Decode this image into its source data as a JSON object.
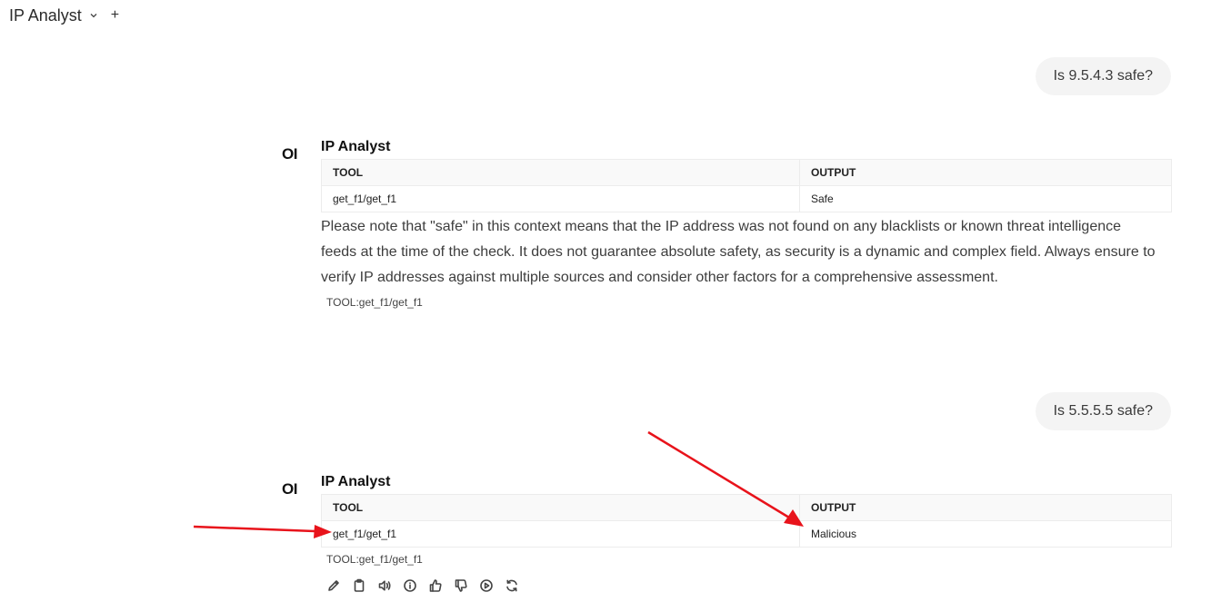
{
  "header": {
    "model_name": "IP Analyst",
    "new_chat_label": "+"
  },
  "conversation": [
    {
      "role": "user",
      "text": "Is 9.5.4.3 safe?"
    },
    {
      "role": "assistant",
      "avatar_text": "OI",
      "name": "IP Analyst",
      "table": {
        "headers": [
          "TOOL",
          "OUTPUT"
        ],
        "rows": [
          [
            "get_f1/get_f1",
            "Safe"
          ]
        ]
      },
      "paragraph": "Please note that \"safe\" in this context means that the IP address was not found on any blacklists or known threat intelligence feeds at the time of the check. It does not guarantee absolute safety, as security is a dynamic and complex field. Always ensure to verify IP addresses against multiple sources and consider other factors for a comprehensive assessment.",
      "tool_tag": "TOOL:get_f1/get_f1"
    },
    {
      "role": "user",
      "text": "Is 5.5.5.5 safe?"
    },
    {
      "role": "assistant",
      "avatar_text": "OI",
      "name": "IP Analyst",
      "table": {
        "headers": [
          "TOOL",
          "OUTPUT"
        ],
        "rows": [
          [
            "get_f1/get_f1",
            "Malicious"
          ]
        ]
      },
      "tool_tag": "TOOL:get_f1/get_f1"
    }
  ],
  "action_icons": [
    "edit-icon",
    "copy-icon",
    "read-aloud-icon",
    "info-icon",
    "thumbs-up-icon",
    "thumbs-down-icon",
    "continue-icon",
    "regenerate-icon"
  ],
  "annotation_color": "#e8131b"
}
